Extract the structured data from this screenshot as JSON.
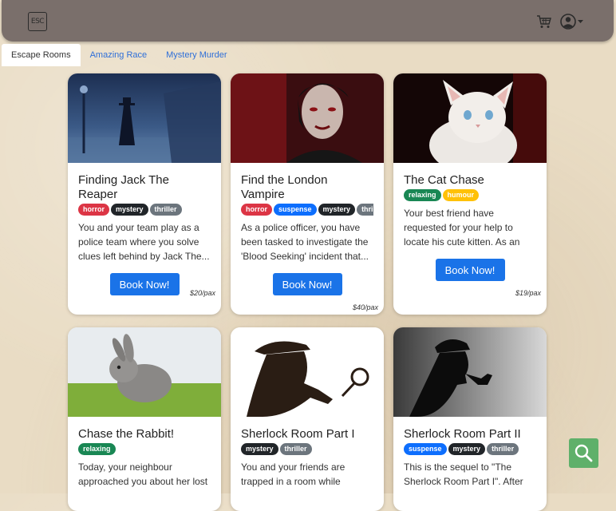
{
  "navbar": {
    "logo_text": "ESC",
    "cart_icon": "cart-icon",
    "user_icon": "user-circle-icon"
  },
  "tabs": [
    {
      "label": "Escape Rooms",
      "active": true
    },
    {
      "label": "Amazing Race",
      "active": false
    },
    {
      "label": "Mystery Murder",
      "active": false
    }
  ],
  "cards": [
    {
      "title": "Finding Jack The Reaper",
      "tags": [
        "horror",
        "mystery",
        "thriller"
      ],
      "description": "You and your team play as a police team where you solve clues left behind by Jack The...",
      "button": "Book Now!",
      "price": "$20/pax",
      "image": "foggy-street-silhouette"
    },
    {
      "title": "Find the London Vampire",
      "tags": [
        "horror",
        "suspense",
        "mystery",
        "thriller"
      ],
      "description": "As a police officer, you have been tasked to investigate the 'Blood Seeking' incident that...",
      "button": "Book Now!",
      "price": "$40/pax",
      "image": "vampire-portrait"
    },
    {
      "title": "The Cat Chase",
      "tags": [
        "relaxing",
        "humour"
      ],
      "description": "Your best friend have requested for your help to locate his cute kitten. As an aspiring detectiv...",
      "button": "Book Now!",
      "price": "$19/pax",
      "image": "white-kitten"
    },
    {
      "title": "Chase the Rabbit!",
      "tags": [
        "relaxing"
      ],
      "description": "Today, your neighbour approached you about her lost",
      "image": "grey-rabbit"
    },
    {
      "title": "Sherlock Room Part I",
      "tags": [
        "mystery",
        "thriller"
      ],
      "description": "You and your friends are trapped in a room while",
      "image": "detective-magnifier"
    },
    {
      "title": "Sherlock Room Part II",
      "tags": [
        "suspense",
        "mystery",
        "thriller"
      ],
      "description": "This is the sequel to \"The Sherlock Room Part I\". After",
      "image": "detective-pipe"
    }
  ],
  "search_fab_icon": "search-icon",
  "colors": {
    "navbar": "#7a6f6b",
    "primary_button": "#1a73e8",
    "search_fab": "#5fb06a"
  }
}
